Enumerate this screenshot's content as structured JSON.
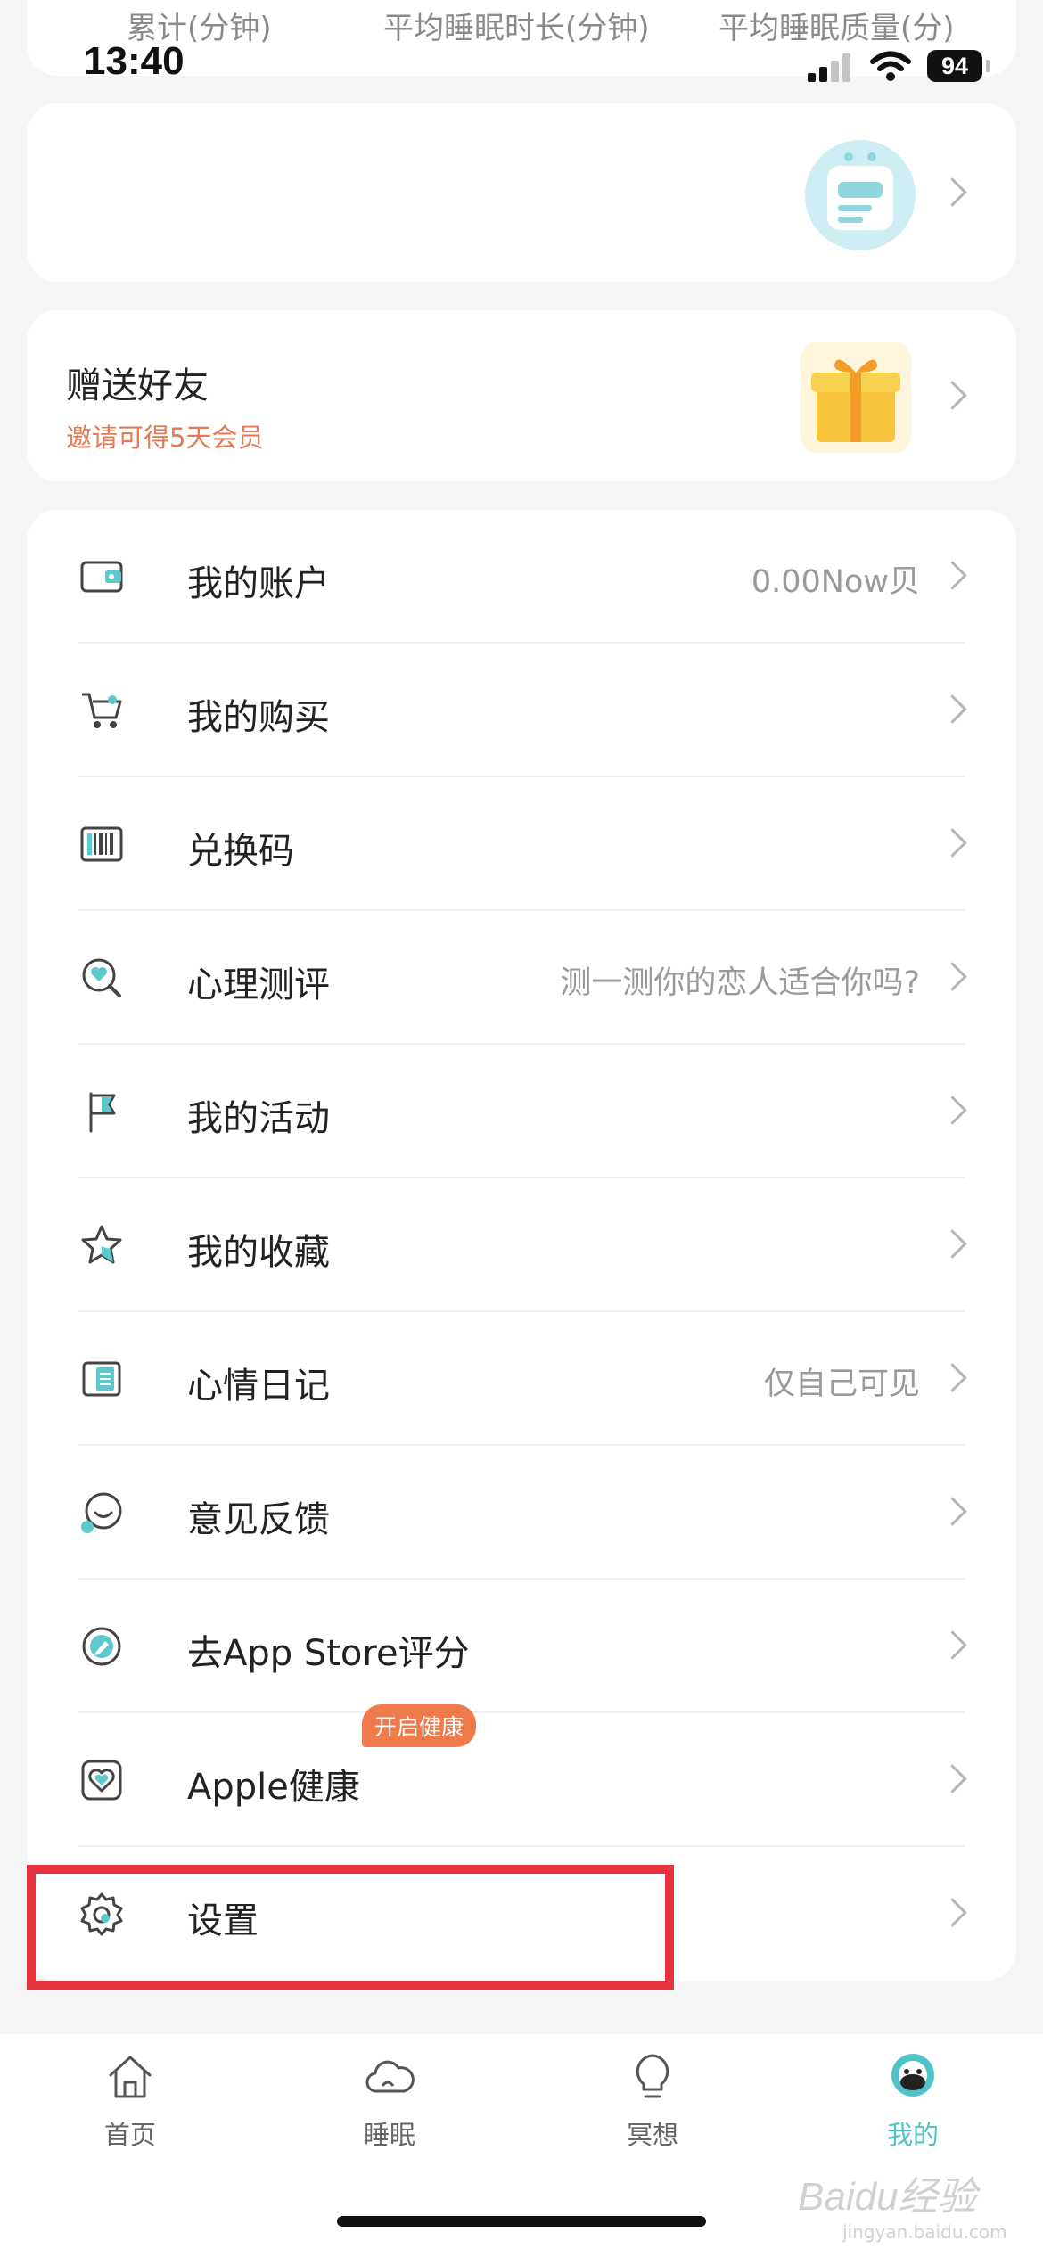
{
  "status_bar": {
    "time": "13:40",
    "battery": "94"
  },
  "stats": {
    "labels": [
      "累计(分钟)",
      "平均睡眠时长(分钟)",
      "平均睡眠质量(分)"
    ]
  },
  "gift_card": {
    "title": "赠送好友",
    "subtitle": "邀请可得5天会员"
  },
  "menu": {
    "items": [
      {
        "label": "我的账户",
        "value": "0.00Now贝",
        "icon": "wallet-icon"
      },
      {
        "label": "我的购买",
        "value": "",
        "icon": "cart-icon"
      },
      {
        "label": "兑换码",
        "value": "",
        "icon": "barcode-icon"
      },
      {
        "label": "心理测评",
        "value": "测一测你的恋人适合你吗?",
        "icon": "heart-search-icon"
      },
      {
        "label": "我的活动",
        "value": "",
        "icon": "flag-icon"
      },
      {
        "label": "我的收藏",
        "value": "",
        "icon": "star-icon"
      },
      {
        "label": "心情日记",
        "value": "仅自己可见",
        "icon": "diary-icon"
      },
      {
        "label": "意见反馈",
        "value": "",
        "icon": "feedback-icon"
      },
      {
        "label": "去App Store评分",
        "value": "",
        "icon": "appstore-icon"
      },
      {
        "label": "Apple健康",
        "value": "",
        "icon": "apple-health-icon",
        "badge": "开启健康"
      },
      {
        "label": "设置",
        "value": "",
        "icon": "settings-icon"
      }
    ]
  },
  "tabbar": {
    "tabs": [
      {
        "label": "首页",
        "icon": "home-icon"
      },
      {
        "label": "睡眠",
        "icon": "cloud-icon"
      },
      {
        "label": "冥想",
        "icon": "lightbulb-icon"
      },
      {
        "label": "我的",
        "icon": "profile-icon",
        "active": true
      }
    ]
  },
  "watermark": {
    "text": "Baidu经验",
    "sub": "jingyan.baidu.com"
  },
  "colors": {
    "accent": "#4fc3c8",
    "badge": "#ef7a4a",
    "invite_text": "#e27a55",
    "highlight": "#e8333f"
  }
}
